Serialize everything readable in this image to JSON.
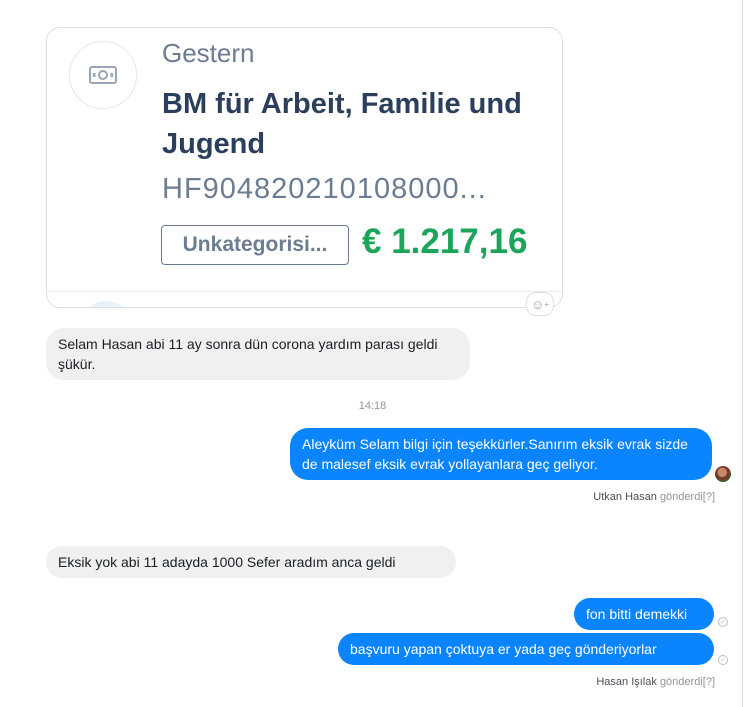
{
  "card": {
    "icon": "banknote-icon",
    "date": "Gestern",
    "title": "BM für Arbeit, Familie und Jugend",
    "reference": "HF904820210108000...",
    "category": "Unkategorisi...",
    "amount": "€ 1.217,16",
    "amount_color": "#1aa55a"
  },
  "reaction_icon": "add-reaction-icon",
  "messages": [
    {
      "text": "Selam Hasan abi 11 ay sonra dün corona yardım parası geldi şükür."
    },
    {
      "text": "Aleyküm Selam bilgi için teşekkürler.Sanırım eksik evrak sizde de malesef eksik evrak yollayanlara geç geliyor."
    },
    {
      "text": "Eksik yok abi 11 adayda 1000 Sefer aradım anca geldi"
    },
    {
      "text": "fon bitti demekki"
    },
    {
      "text": "başvuru yapan çoktuya er yada geç gönderiyorlar"
    }
  ],
  "timestamp": "14:18",
  "seen": [
    {
      "name": "Utkan Hasan",
      "label": "gönderdi",
      "help": "[?]"
    },
    {
      "name": "Hasan Işılak",
      "label": "gönderdi",
      "help": "[?]"
    }
  ],
  "colors": {
    "outgoing": "#0a84ff",
    "incoming": "#f1f0f0"
  }
}
